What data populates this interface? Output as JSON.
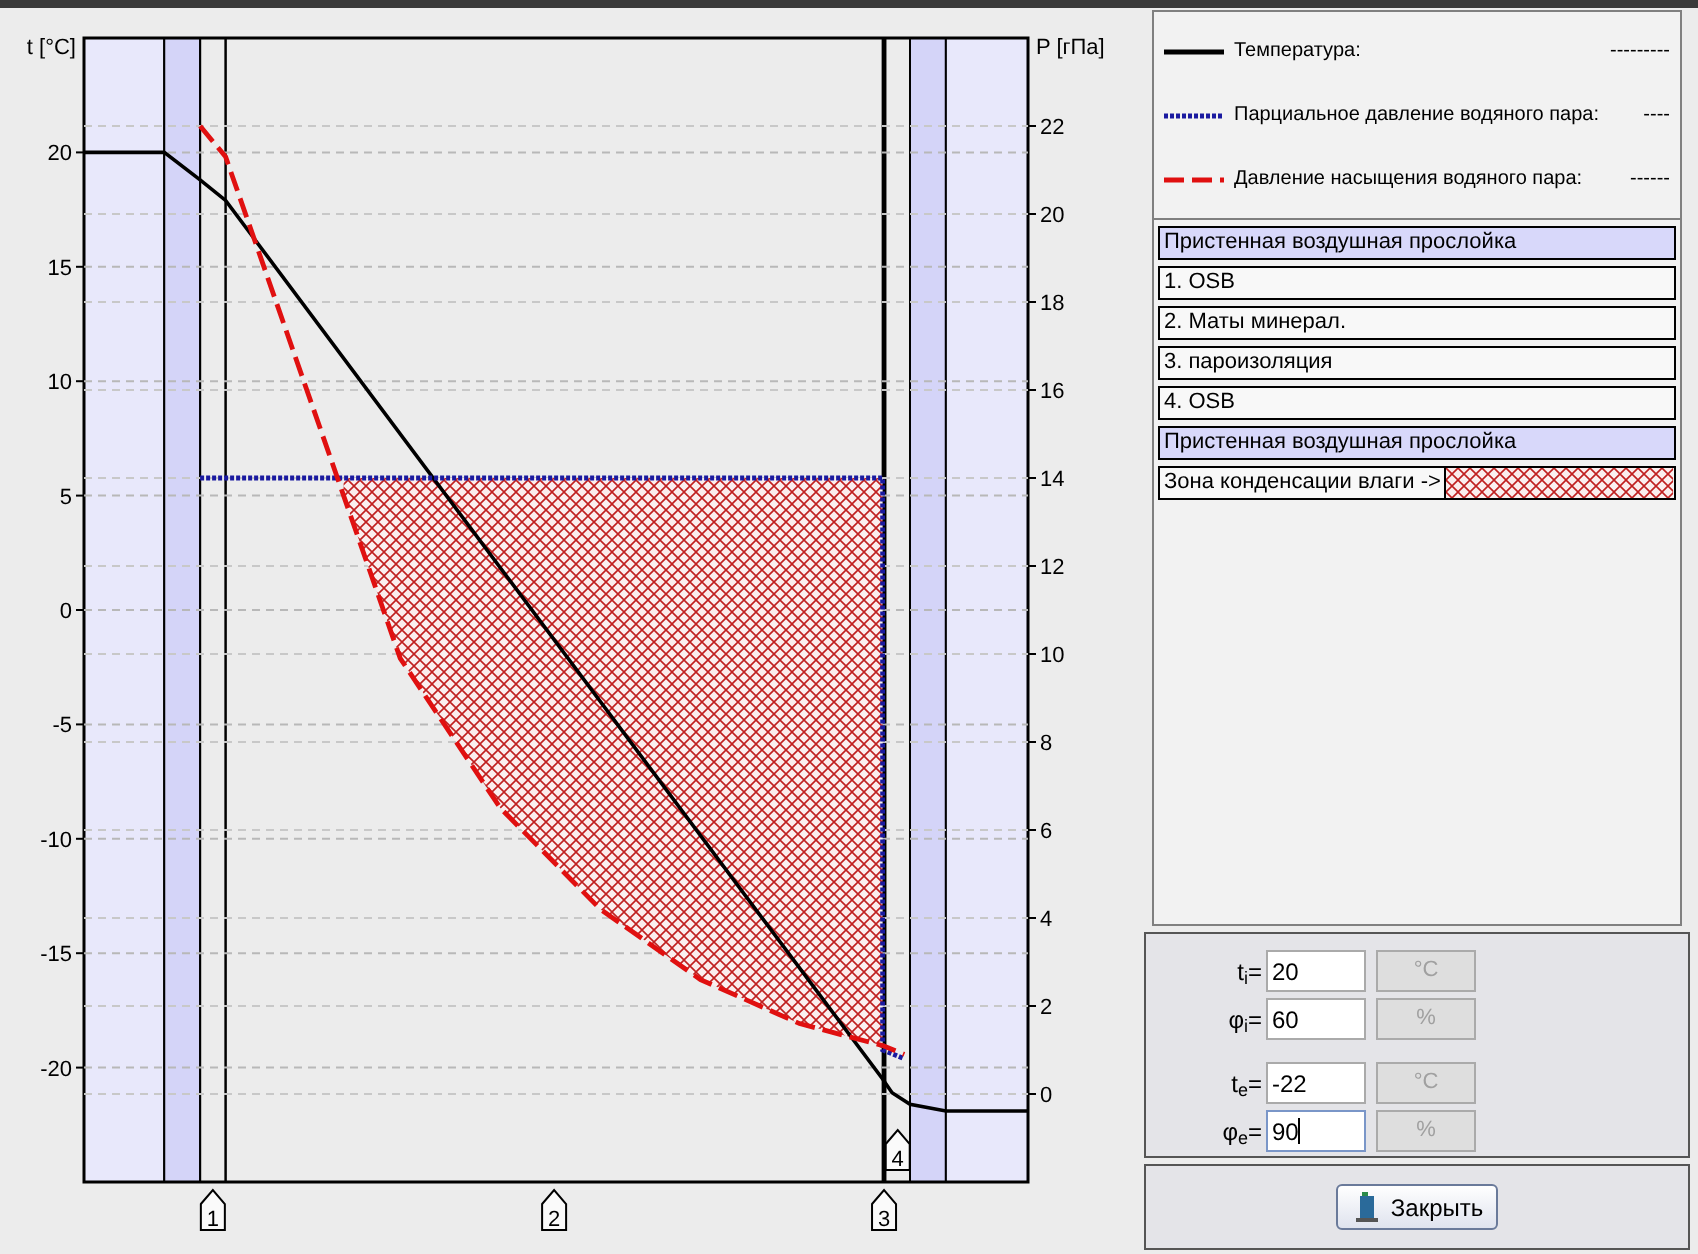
{
  "chart": {
    "left_axis_label": "t [°C]",
    "right_axis_label": "P [гПа]",
    "left_ticks": [
      "20",
      "15",
      "10",
      "5",
      "0",
      "-5",
      "-10",
      "-15",
      "-20"
    ],
    "right_ticks": [
      "22",
      "20",
      "18",
      "16",
      "14",
      "12",
      "10",
      "8",
      "6",
      "4",
      "2",
      "0"
    ],
    "markers": [
      "4",
      "1",
      "2",
      "3"
    ]
  },
  "legend": [
    {
      "label": "Температура:",
      "value": "---------",
      "color": "#000000"
    },
    {
      "label": "Парциальное давление водяного пара:",
      "value": "----",
      "color": "#1a1aa0"
    },
    {
      "label": "Давление насыщения водяного пара:",
      "value": "------",
      "color": "#e01010"
    }
  ],
  "layers": [
    {
      "kind": "air",
      "label": "Пристенная воздушная прослойка"
    },
    {
      "kind": "layer",
      "label": "1. OSB"
    },
    {
      "kind": "layer",
      "label": "2. Маты минерал."
    },
    {
      "kind": "layer",
      "label": "3. пароизоляция"
    },
    {
      "kind": "layer",
      "label": "4. OSB"
    },
    {
      "kind": "air",
      "label": "Пристенная воздушная прослойка"
    },
    {
      "kind": "condensation",
      "label": "Зона конденсации влаги ->"
    }
  ],
  "inputs": [
    {
      "label": "t$_{i}$=",
      "value": "20",
      "unit": "°C",
      "unit_disabled": true,
      "focused": false
    },
    {
      "label": "φ$_{i}$=",
      "value": "60",
      "unit": "%",
      "unit_disabled": true,
      "focused": false
    },
    {
      "label": "t$_{e}$=",
      "value": "-22",
      "unit": "°C",
      "unit_disabled": true,
      "focused": false
    },
    {
      "label": "φ$_{e}$=",
      "value": "90",
      "unit": "%",
      "unit_disabled": true,
      "focused": true
    }
  ],
  "close_button": {
    "label": "Закрыть"
  }
}
